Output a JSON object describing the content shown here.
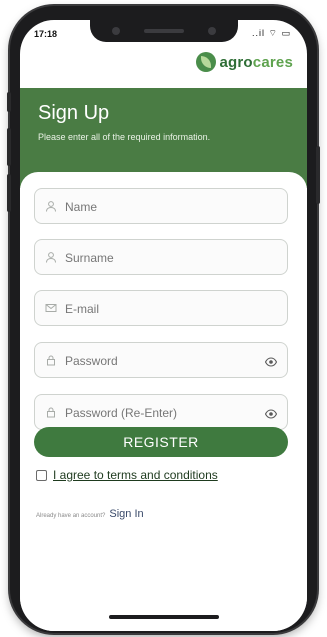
{
  "status_bar": {
    "time": "17:18",
    "indicators": "..il ⌔ ▭"
  },
  "brand": {
    "prefix": "agro",
    "suffix": "cares",
    "icon": "leaf-logo-icon"
  },
  "header": {
    "title": "Sign Up",
    "subtitle": "Please enter all of the required information."
  },
  "form": {
    "fields": [
      {
        "name": "name-field",
        "placeholder": "Name",
        "icon": "person-icon"
      },
      {
        "name": "surname-field",
        "placeholder": "Surname",
        "icon": "person-icon"
      },
      {
        "name": "email-field",
        "placeholder": "E-mail",
        "icon": "mail-icon"
      },
      {
        "name": "password-field",
        "placeholder": "Password",
        "icon": "lock-icon",
        "eye": "eye-icon"
      },
      {
        "name": "password-reenter-field",
        "placeholder": "Password (Re-Enter)",
        "icon": "lock-icon",
        "eye": "eye-icon"
      }
    ],
    "register_label": "REGISTER",
    "terms_label": "I agree to terms and conditions",
    "have_account": "Already have an account?",
    "sign_in_label": "Sign In"
  },
  "colors": {
    "primary": "#4a7c44",
    "button": "#3f7a3f",
    "logo_green": "#2f6e36"
  }
}
